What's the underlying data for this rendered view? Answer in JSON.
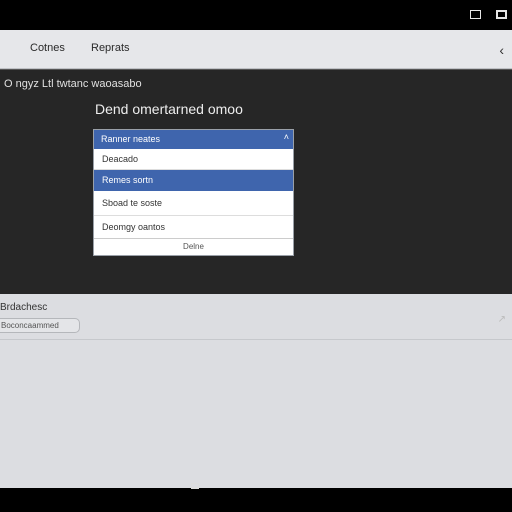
{
  "toolbar": {
    "items": [
      "Cotnes",
      "Reprats"
    ]
  },
  "dark": {
    "label": "O ngyz Ltl twtanc waoasabo",
    "heading": "Dend omertarned omoo"
  },
  "panel": {
    "header": "Ranner neates",
    "rows": [
      "Deacado",
      "Remes sortn",
      "Sboad te soste",
      "Deomgy oantos"
    ],
    "footer": "Delne"
  },
  "bottom": {
    "label": "Brdachesc",
    "field_value": "Boconcaammed"
  }
}
